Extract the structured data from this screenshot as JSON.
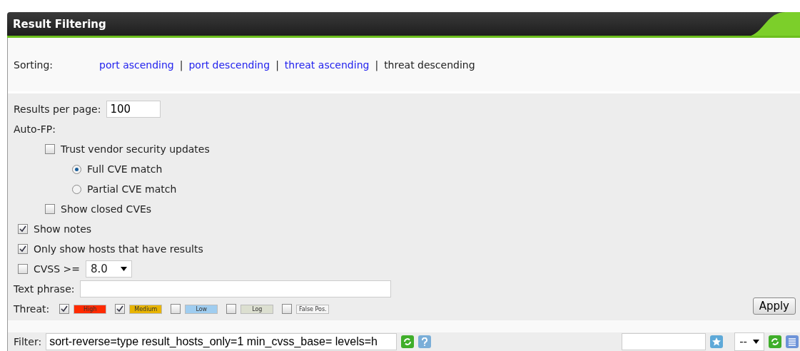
{
  "panel": {
    "title": "Result Filtering"
  },
  "sorting": {
    "label": "Sorting:",
    "separator": "|",
    "options": [
      {
        "label": "port ascending",
        "selected": false
      },
      {
        "label": "port descending",
        "selected": false
      },
      {
        "label": "threat ascending",
        "selected": false
      },
      {
        "label": "threat descending",
        "selected": true
      }
    ]
  },
  "results_per_page": {
    "label": "Results per page:",
    "value": "100"
  },
  "auto_fp": {
    "label": "Auto-FP:",
    "trust": {
      "label": "Trust vendor security updates",
      "checked": false
    },
    "match": [
      {
        "label": "Full CVE match",
        "selected": true
      },
      {
        "label": "Partial CVE match",
        "selected": false
      }
    ],
    "closed": {
      "label": "Show closed CVEs",
      "checked": false
    }
  },
  "options": [
    {
      "kind": "check",
      "label": "Show notes",
      "checked": true
    },
    {
      "kind": "check",
      "label": "Only show hosts that have results",
      "checked": true
    },
    {
      "kind": "cvss",
      "label": "CVSS >=",
      "checked": false,
      "value": "8.0"
    }
  ],
  "text_phrase": {
    "label": "Text phrase:"
  },
  "threat": {
    "label": "Threat:",
    "levels": [
      {
        "label": "High",
        "checked": true,
        "color": "#ff2a00"
      },
      {
        "label": "Medium",
        "checked": true,
        "color": "#e8b400"
      },
      {
        "label": "Low",
        "checked": false,
        "color": "#9fcdf0"
      },
      {
        "label": "Log",
        "checked": false,
        "color": "#dcdfd0"
      },
      {
        "label": "False Pos.",
        "checked": false,
        "color": "#f5f5f5"
      }
    ]
  },
  "apply": "Apply",
  "filter": {
    "label": "Filter:",
    "value": "sort-reverse=type result_hosts_only=1 min_cvss_base= levels=h",
    "select": "--"
  }
}
